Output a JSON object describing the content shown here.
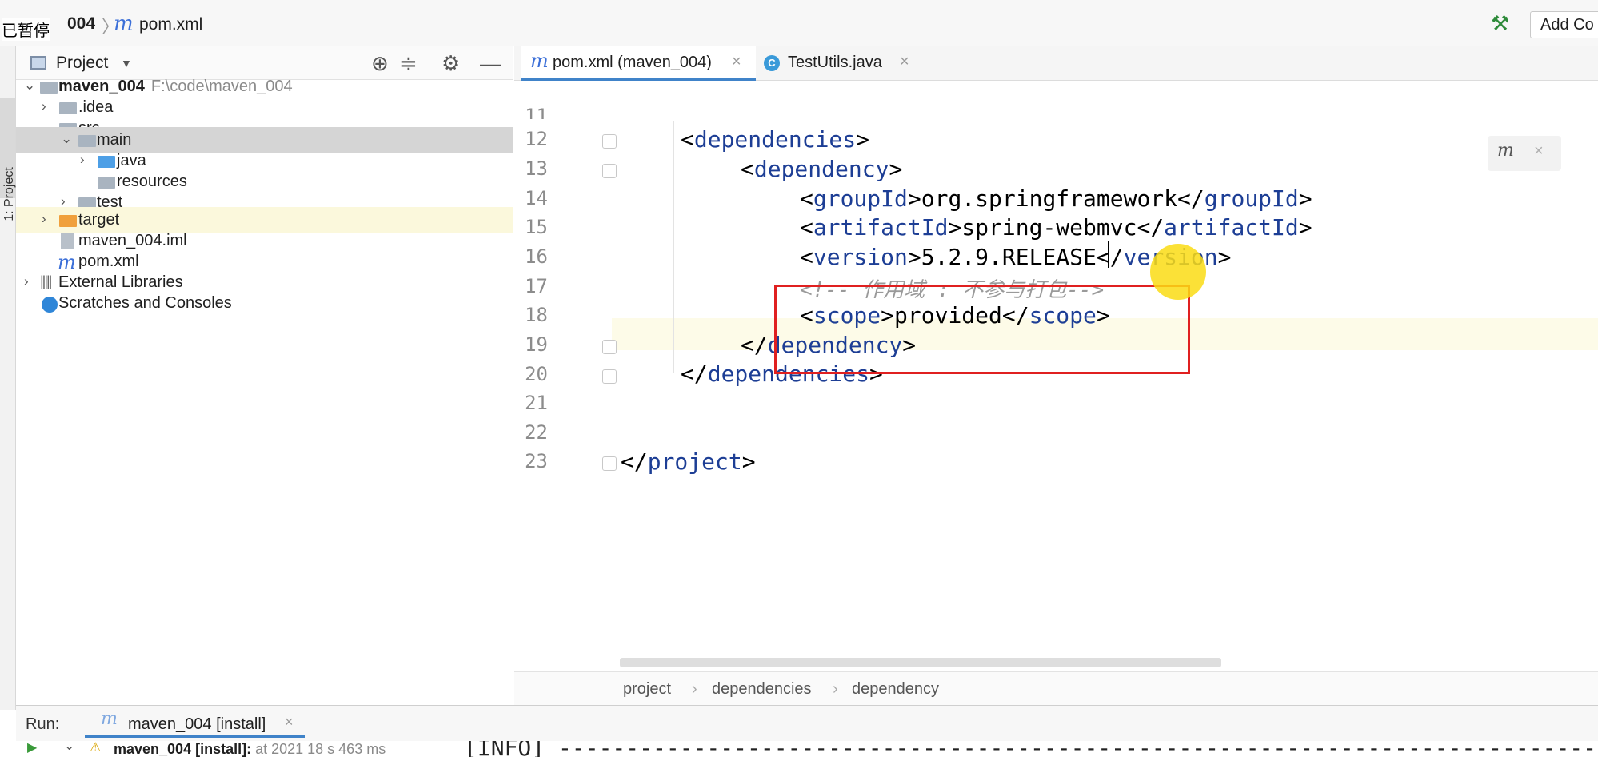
{
  "overlay": {
    "paused_text": "已暂停"
  },
  "navbar": {
    "project": "004",
    "file_icon": "m",
    "file": "pom.xml",
    "add_config": "Add Co"
  },
  "left_strip": {
    "label": "1: Project"
  },
  "project_panel": {
    "title": "Project",
    "tree": [
      {
        "label": "maven_004",
        "path": "F:\\code\\maven_004"
      },
      {
        "label": ".idea"
      },
      {
        "label": "src"
      },
      {
        "label": "main"
      },
      {
        "label": "java"
      },
      {
        "label": "resources"
      },
      {
        "label": "test"
      },
      {
        "label": "target"
      },
      {
        "label": "maven_004.iml"
      },
      {
        "label": "pom.xml"
      },
      {
        "label": "External Libraries"
      },
      {
        "label": "Scratches and Consoles"
      }
    ]
  },
  "tabs": [
    {
      "icon": "m",
      "label": "pom.xml (maven_004)"
    },
    {
      "icon": "C",
      "label": "TestUtils.java"
    }
  ],
  "editor": {
    "line_numbers": [
      "11",
      "12",
      "13",
      "14",
      "15",
      "16",
      "17",
      "18",
      "19",
      "20",
      "21",
      "22",
      "23"
    ],
    "lines": [
      {
        "t1": "<",
        "tag": "dependencies",
        "t2": ">"
      },
      {
        "t1": "<",
        "tag": "dependency",
        "t2": ">"
      },
      {
        "t1": "<",
        "tag": "groupId",
        "t2": ">",
        "text": "org.springframework",
        "t3": "</",
        "tag2": "groupId",
        "t4": ">"
      },
      {
        "t1": "<",
        "tag": "artifactId",
        "t2": ">",
        "text": "spring-webmvc",
        "t3": "</",
        "tag2": "artifactId",
        "t4": ">"
      },
      {
        "t1": "<",
        "tag": "version",
        "t2": ">",
        "text": "5.2.9.RELEASE",
        "t3": "</",
        "tag2": "version",
        "t4": ">"
      },
      {
        "comment": "<!-- 作用域 : 不参与打包-->"
      },
      {
        "t1": "<",
        "tag": "scope",
        "t2": ">",
        "text": "provided",
        "t3": "</",
        "tag2": "scope",
        "t4": ">"
      },
      {
        "t1": "</",
        "tag": "dependency",
        "t2": ">"
      },
      {
        "t1": "</",
        "tag": "dependencies",
        "t2": ">"
      },
      {
        "t1": "</",
        "tag": "project",
        "t2": ">"
      }
    ],
    "maven_popup_icon": "m"
  },
  "breadcrumb": [
    "project",
    "dependencies",
    "dependency"
  ],
  "run": {
    "label": "Run:",
    "tab_icon": "m",
    "tab_label": "maven_004 [install]",
    "item_name": "maven_004 [install]:",
    "item_time": "at 2021 18 s 463 ms",
    "output": "[INFO] ------------------------------------------------------------------------------------------"
  }
}
